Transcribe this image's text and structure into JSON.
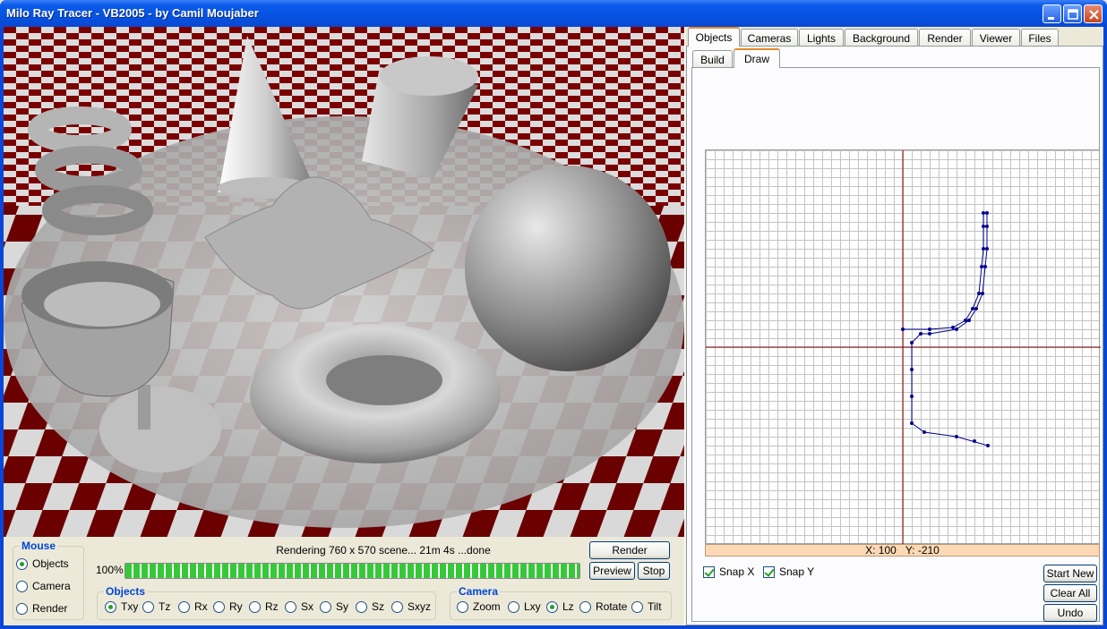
{
  "window": {
    "title": "Milo Ray Tracer - VB2005 - by Camil Moujaber"
  },
  "status": {
    "message": "Rendering 760 x 570 scene... 21m 4s ...done",
    "progress_label": "100%",
    "progress_value": 1.0
  },
  "buttons": {
    "render": "Render",
    "preview": "Preview",
    "stop": "Stop",
    "start_new": "Start New",
    "clear_all": "Clear All",
    "undo": "Undo"
  },
  "mouse_group": {
    "title": "Mouse",
    "options": [
      "Objects",
      "Camera",
      "Render"
    ],
    "selected": "Objects"
  },
  "objects_group": {
    "title": "Objects",
    "options": [
      "Txy",
      "Tz",
      "Rx",
      "Ry",
      "Rz",
      "Sx",
      "Sy",
      "Sz",
      "Sxyz"
    ],
    "selected": "Txy"
  },
  "camera_group": {
    "title": "Camera",
    "options": [
      "Zoom",
      "Lxy",
      "Lz",
      "Rotate",
      "Tilt"
    ],
    "selected": "Lz"
  },
  "tabs": [
    "Objects",
    "Cameras",
    "Lights",
    "Background",
    "Render",
    "Viewer",
    "Files"
  ],
  "active_tab": "Objects",
  "subtabs": [
    "Build",
    "Draw"
  ],
  "active_subtab": "Draw",
  "coords": {
    "x": "X: 100",
    "y": "Y: -210"
  },
  "snap": {
    "x_label": "Snap X",
    "x_checked": true,
    "y_label": "Snap Y",
    "y_checked": true
  },
  "colors": {
    "axis": "#800000",
    "curve": "#00008b",
    "coord_bar": "#fcd9b4",
    "checker_dark": "#6b0000"
  }
}
